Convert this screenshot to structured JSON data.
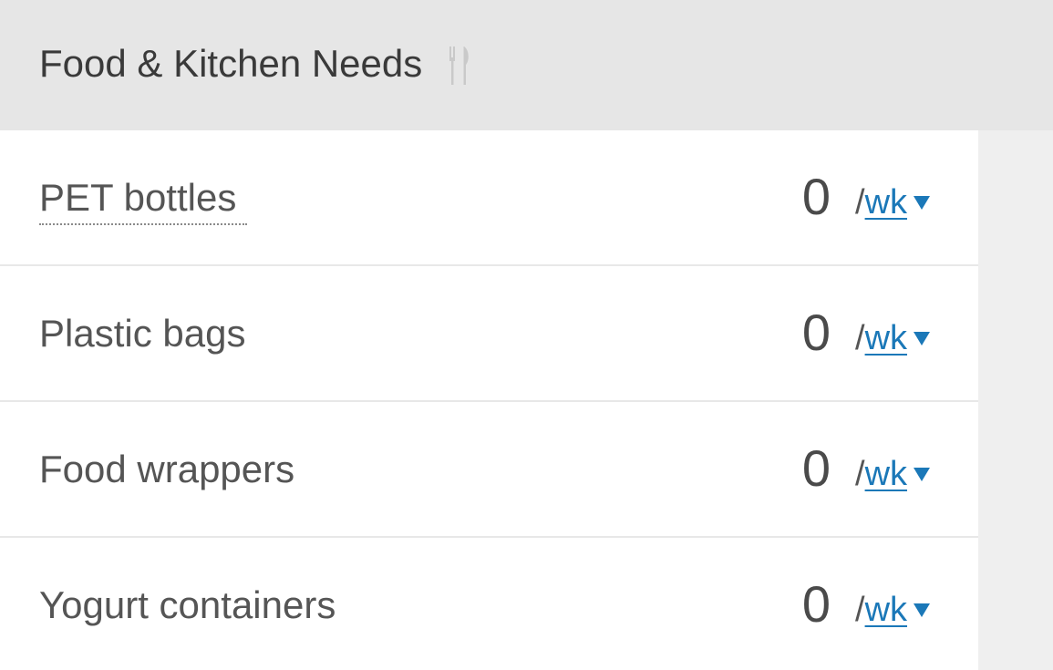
{
  "header": {
    "title": "Food & Kitchen Needs",
    "icon": "utensils-icon"
  },
  "items": [
    {
      "label": "PET bottles",
      "value": "0",
      "slash": "/",
      "unit": "wk",
      "has_tooltip": true
    },
    {
      "label": "Plastic bags",
      "value": "0",
      "slash": "/",
      "unit": "wk",
      "has_tooltip": false
    },
    {
      "label": "Food wrappers",
      "value": "0",
      "slash": "/",
      "unit": "wk",
      "has_tooltip": false
    },
    {
      "label": "Yogurt containers",
      "value": "0",
      "slash": "/",
      "unit": "wk",
      "has_tooltip": false
    }
  ],
  "colors": {
    "header_bg": "#e6e6e6",
    "row_bg": "#ffffff",
    "link": "#1b78b8",
    "text": "#555555"
  }
}
